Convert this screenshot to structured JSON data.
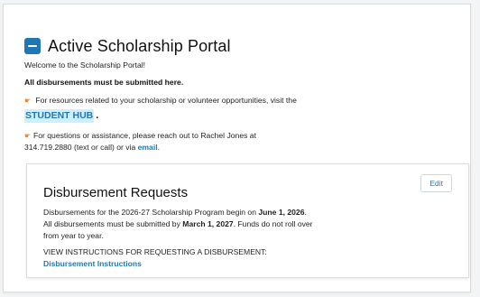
{
  "portal": {
    "title": "Active Scholarship Portal",
    "welcome": "Welcome to the Scholarship Portal!",
    "notice": "All disbursements must be submitted here.",
    "resource_text": "For resources related to your scholarship or volunteer opportunities, visit the",
    "student_hub_label": "STUDENT HUB",
    "student_hub_suffix": ".",
    "contact_text": "For questions or assistance, please reach out to Rachel Jones at",
    "contact_text_2": "314.719.2880 (text or call) or via",
    "email_label": "email",
    "contact_period": ".",
    "icon": "collapse-minus-icon",
    "accent_color": "#1f78b4",
    "highlight_color": "#cfefff"
  },
  "disbursement": {
    "title": "Disbursement Requests",
    "edit_label": "Edit",
    "body_1": "Disbursements for the 2026-27 Scholarship Program begin on ",
    "begin_date": "June 1, 2026",
    "body_2": ". All disbursements must be submitted by ",
    "deadline": "March 1, 2027",
    "body_3": ". Funds do not roll over from year to year.",
    "instructions_heading": "VIEW INSTRUCTIONS FOR REQUESTING A DISBURSEMENT:",
    "instructions_link": "Disbursement Instructions"
  }
}
